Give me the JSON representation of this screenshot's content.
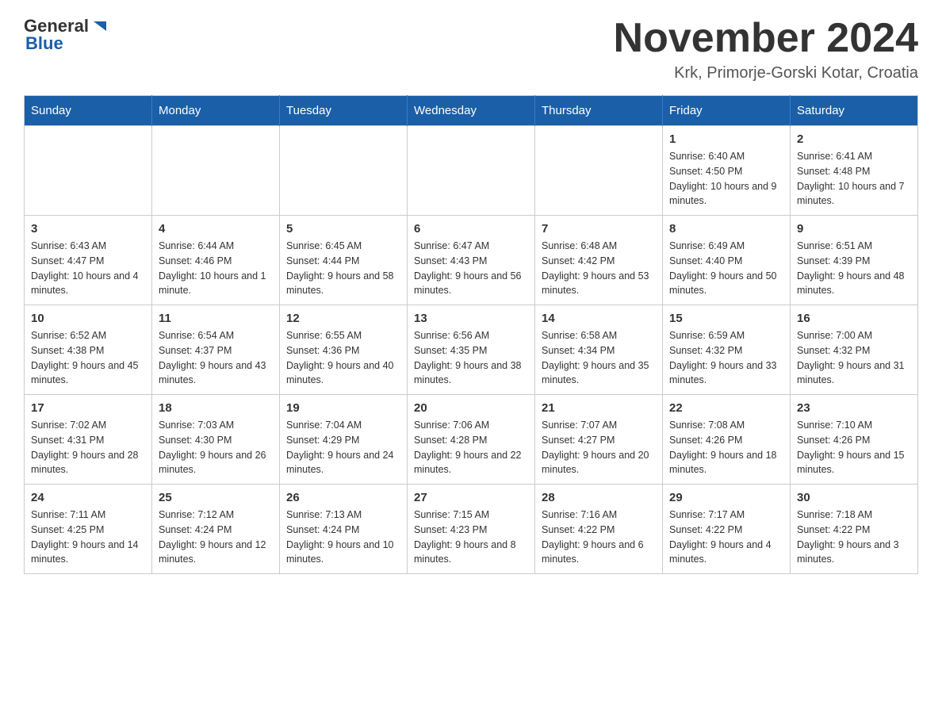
{
  "header": {
    "logo_general": "General",
    "logo_blue": "Blue",
    "month_title": "November 2024",
    "location": "Krk, Primorje-Gorski Kotar, Croatia"
  },
  "days_of_week": [
    "Sunday",
    "Monday",
    "Tuesday",
    "Wednesday",
    "Thursday",
    "Friday",
    "Saturday"
  ],
  "weeks": [
    {
      "days": [
        {
          "number": "",
          "info": ""
        },
        {
          "number": "",
          "info": ""
        },
        {
          "number": "",
          "info": ""
        },
        {
          "number": "",
          "info": ""
        },
        {
          "number": "",
          "info": ""
        },
        {
          "number": "1",
          "info": "Sunrise: 6:40 AM\nSunset: 4:50 PM\nDaylight: 10 hours and 9 minutes."
        },
        {
          "number": "2",
          "info": "Sunrise: 6:41 AM\nSunset: 4:48 PM\nDaylight: 10 hours and 7 minutes."
        }
      ]
    },
    {
      "days": [
        {
          "number": "3",
          "info": "Sunrise: 6:43 AM\nSunset: 4:47 PM\nDaylight: 10 hours and 4 minutes."
        },
        {
          "number": "4",
          "info": "Sunrise: 6:44 AM\nSunset: 4:46 PM\nDaylight: 10 hours and 1 minute."
        },
        {
          "number": "5",
          "info": "Sunrise: 6:45 AM\nSunset: 4:44 PM\nDaylight: 9 hours and 58 minutes."
        },
        {
          "number": "6",
          "info": "Sunrise: 6:47 AM\nSunset: 4:43 PM\nDaylight: 9 hours and 56 minutes."
        },
        {
          "number": "7",
          "info": "Sunrise: 6:48 AM\nSunset: 4:42 PM\nDaylight: 9 hours and 53 minutes."
        },
        {
          "number": "8",
          "info": "Sunrise: 6:49 AM\nSunset: 4:40 PM\nDaylight: 9 hours and 50 minutes."
        },
        {
          "number": "9",
          "info": "Sunrise: 6:51 AM\nSunset: 4:39 PM\nDaylight: 9 hours and 48 minutes."
        }
      ]
    },
    {
      "days": [
        {
          "number": "10",
          "info": "Sunrise: 6:52 AM\nSunset: 4:38 PM\nDaylight: 9 hours and 45 minutes."
        },
        {
          "number": "11",
          "info": "Sunrise: 6:54 AM\nSunset: 4:37 PM\nDaylight: 9 hours and 43 minutes."
        },
        {
          "number": "12",
          "info": "Sunrise: 6:55 AM\nSunset: 4:36 PM\nDaylight: 9 hours and 40 minutes."
        },
        {
          "number": "13",
          "info": "Sunrise: 6:56 AM\nSunset: 4:35 PM\nDaylight: 9 hours and 38 minutes."
        },
        {
          "number": "14",
          "info": "Sunrise: 6:58 AM\nSunset: 4:34 PM\nDaylight: 9 hours and 35 minutes."
        },
        {
          "number": "15",
          "info": "Sunrise: 6:59 AM\nSunset: 4:32 PM\nDaylight: 9 hours and 33 minutes."
        },
        {
          "number": "16",
          "info": "Sunrise: 7:00 AM\nSunset: 4:32 PM\nDaylight: 9 hours and 31 minutes."
        }
      ]
    },
    {
      "days": [
        {
          "number": "17",
          "info": "Sunrise: 7:02 AM\nSunset: 4:31 PM\nDaylight: 9 hours and 28 minutes."
        },
        {
          "number": "18",
          "info": "Sunrise: 7:03 AM\nSunset: 4:30 PM\nDaylight: 9 hours and 26 minutes."
        },
        {
          "number": "19",
          "info": "Sunrise: 7:04 AM\nSunset: 4:29 PM\nDaylight: 9 hours and 24 minutes."
        },
        {
          "number": "20",
          "info": "Sunrise: 7:06 AM\nSunset: 4:28 PM\nDaylight: 9 hours and 22 minutes."
        },
        {
          "number": "21",
          "info": "Sunrise: 7:07 AM\nSunset: 4:27 PM\nDaylight: 9 hours and 20 minutes."
        },
        {
          "number": "22",
          "info": "Sunrise: 7:08 AM\nSunset: 4:26 PM\nDaylight: 9 hours and 18 minutes."
        },
        {
          "number": "23",
          "info": "Sunrise: 7:10 AM\nSunset: 4:26 PM\nDaylight: 9 hours and 15 minutes."
        }
      ]
    },
    {
      "days": [
        {
          "number": "24",
          "info": "Sunrise: 7:11 AM\nSunset: 4:25 PM\nDaylight: 9 hours and 14 minutes."
        },
        {
          "number": "25",
          "info": "Sunrise: 7:12 AM\nSunset: 4:24 PM\nDaylight: 9 hours and 12 minutes."
        },
        {
          "number": "26",
          "info": "Sunrise: 7:13 AM\nSunset: 4:24 PM\nDaylight: 9 hours and 10 minutes."
        },
        {
          "number": "27",
          "info": "Sunrise: 7:15 AM\nSunset: 4:23 PM\nDaylight: 9 hours and 8 minutes."
        },
        {
          "number": "28",
          "info": "Sunrise: 7:16 AM\nSunset: 4:22 PM\nDaylight: 9 hours and 6 minutes."
        },
        {
          "number": "29",
          "info": "Sunrise: 7:17 AM\nSunset: 4:22 PM\nDaylight: 9 hours and 4 minutes."
        },
        {
          "number": "30",
          "info": "Sunrise: 7:18 AM\nSunset: 4:22 PM\nDaylight: 9 hours and 3 minutes."
        }
      ]
    }
  ]
}
